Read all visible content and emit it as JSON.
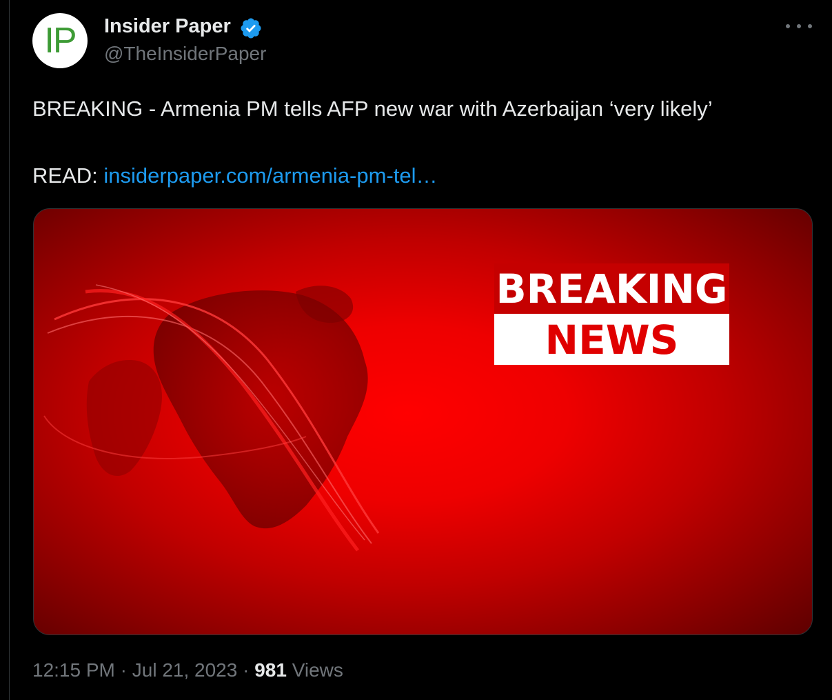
{
  "author": {
    "avatar_text": "IP",
    "display_name": "Insider Paper",
    "handle": "@TheInsiderPaper",
    "verified": true
  },
  "tweet": {
    "text": "BREAKING - Armenia PM tells AFP new war with Azerbaijan ‘very likely’",
    "read_label": "READ:",
    "link_text": "insiderpaper.com/armenia-pm-tel…"
  },
  "media": {
    "breaking_text": "BREAKING",
    "news_text": "NEWS"
  },
  "meta": {
    "time": "12:15 PM",
    "separator": "·",
    "date": "Jul 21, 2023",
    "views_count": "981",
    "views_label": "Views"
  },
  "icons": {
    "verified": "verified-badge-icon",
    "more": "more-icon"
  },
  "colors": {
    "background": "#000000",
    "text": "#e7e9ea",
    "muted": "#71767b",
    "link": "#1d9bf0",
    "verified": "#1d9bf0",
    "media_red": "#ee0000"
  }
}
